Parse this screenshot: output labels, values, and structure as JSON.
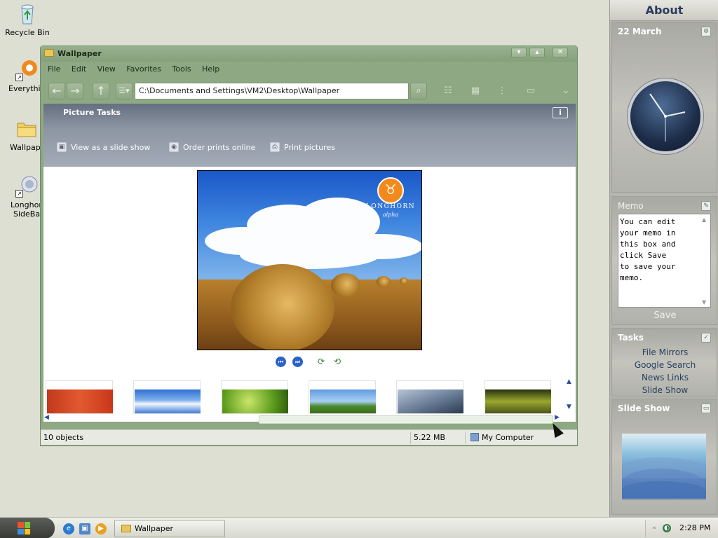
{
  "desktop": {
    "icons": [
      {
        "label": "Recycle Bin"
      },
      {
        "label": "Everythin"
      },
      {
        "label": "Wallpape"
      },
      {
        "label_line1": "Longhor",
        "label_line2": "SideBar"
      }
    ]
  },
  "window": {
    "title": "Wallpaper",
    "controls": {
      "minimize": "▾",
      "maximize": "▴",
      "close": "✕"
    },
    "menu": [
      "File",
      "Edit",
      "View",
      "Favorites",
      "Tools",
      "Help"
    ],
    "address": "C:\\Documents and Settings\\VM2\\Desktop\\Wallpaper",
    "picture_tasks": {
      "title": "Picture Tasks",
      "info": "i",
      "links": [
        "View as a slide show",
        "Order prints online",
        "Print pictures"
      ]
    },
    "preview": {
      "logo_text": "LONGHORN",
      "logo_sub": "alpha"
    },
    "status": {
      "objects": "10 objects",
      "size": "5.22 MB",
      "location": "My Computer"
    }
  },
  "sidebar": {
    "about": "About",
    "date": "22 March",
    "memo": {
      "title": "Memo",
      "text": "You can edit\nyour memo in\nthis box and\nclick Save\nto save your\nmemo.",
      "save_label": "Save"
    },
    "tasks": {
      "title": "Tasks",
      "items": [
        "File Mirrors",
        "Google Search",
        "News Links",
        "Slide Show"
      ]
    },
    "slideshow": {
      "title": "Slide Show"
    }
  },
  "taskbar": {
    "window_button": "Wallpaper",
    "time": "2:28 PM"
  },
  "colors": {
    "window_frame": "#8da882",
    "task_pane": "#8d96a3",
    "sidebar": "#b5b5af",
    "link_blue": "#27405f"
  }
}
